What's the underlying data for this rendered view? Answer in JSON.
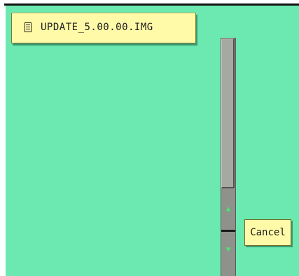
{
  "file_list": {
    "items": [
      {
        "name": "UPDATE_5.00.00.IMG",
        "icon": "file-icon"
      }
    ]
  },
  "scrollbar": {
    "up_icon": "arrow-up-icon",
    "down_icon": "arrow-down-icon",
    "up_glyph": "▲",
    "down_glyph": "▼"
  },
  "actions": {
    "cancel_label": "Cancel"
  },
  "colors": {
    "background": "#6be9b0",
    "item_background": "#fffaa8",
    "scrollbar": "#9e9e9e",
    "arrow": "#3cf06e"
  }
}
